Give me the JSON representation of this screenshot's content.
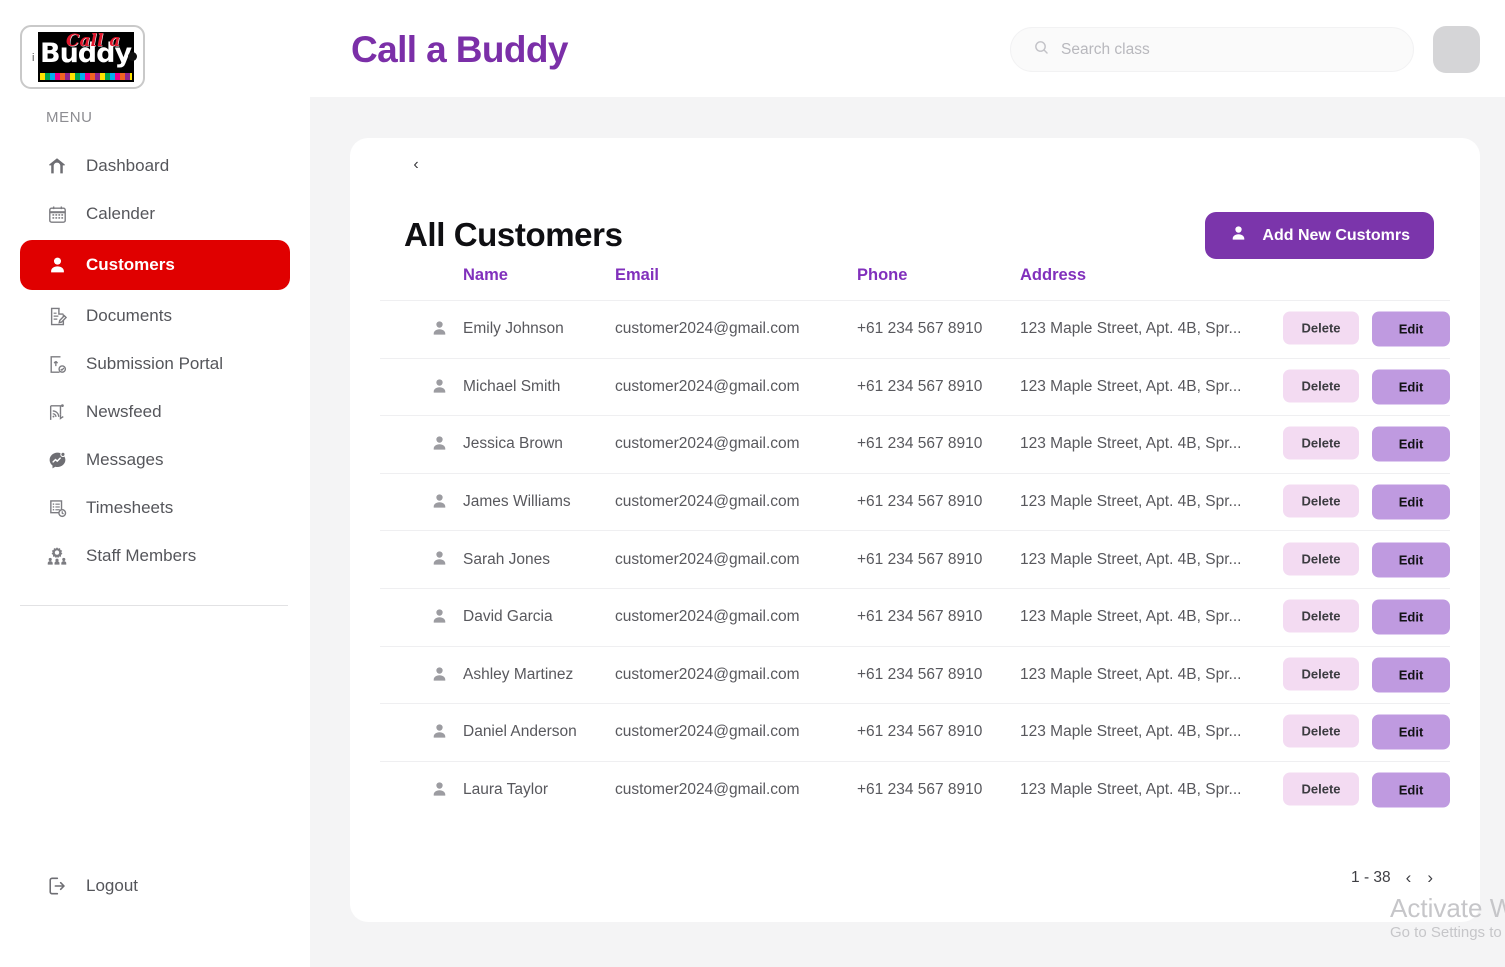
{
  "brand": {
    "logo_main": "Buddy",
    "logo_script": "Call a",
    "logo_left_letter": "i",
    "app_title": "Call a Buddy",
    "accent_purple": "#7b2fa8",
    "accent_red": "#e00000"
  },
  "sidebar": {
    "menu_label": "MENU",
    "items": [
      {
        "label": "Dashboard",
        "icon": "home-icon",
        "active": false
      },
      {
        "label": "Calender",
        "icon": "calendar-icon",
        "active": false
      },
      {
        "label": "Customers",
        "icon": "user-icon",
        "active": true
      },
      {
        "label": "Documents",
        "icon": "document-edit-icon",
        "active": false
      },
      {
        "label": "Submission Portal",
        "icon": "upload-check-icon",
        "active": false
      },
      {
        "label": "Newsfeed",
        "icon": "rss-icon",
        "active": false
      },
      {
        "label": "Messages",
        "icon": "message-chart-icon",
        "active": false
      },
      {
        "label": "Timesheets",
        "icon": "timesheet-clock-icon",
        "active": false
      },
      {
        "label": "Staff Members",
        "icon": "staff-group-icon",
        "active": false
      }
    ],
    "logout_label": "Logout"
  },
  "search": {
    "placeholder": "Search class",
    "value": ""
  },
  "main": {
    "back_label": "‹",
    "page_title": "All Customers",
    "add_button_label": "Add New Customrs",
    "columns": [
      "Name",
      "Email",
      "Phone",
      "Address"
    ],
    "rows": [
      {
        "name": "Emily Johnson",
        "email": "customer2024@gmail.com",
        "phone": "+61 234 567 8910",
        "address": "123 Maple Street, Apt. 4B, Spr..."
      },
      {
        "name": "Michael Smith",
        "email": "customer2024@gmail.com",
        "phone": "+61 234 567 8910",
        "address": "123 Maple Street, Apt. 4B, Spr..."
      },
      {
        "name": "Jessica Brown",
        "email": "customer2024@gmail.com",
        "phone": "+61 234 567 8910",
        "address": "123 Maple Street, Apt. 4B, Spr..."
      },
      {
        "name": "James Williams",
        "email": "customer2024@gmail.com",
        "phone": "+61 234 567 8910",
        "address": "123 Maple Street, Apt. 4B, Spr..."
      },
      {
        "name": "Sarah Jones",
        "email": "customer2024@gmail.com",
        "phone": "+61 234 567 8910",
        "address": "123 Maple Street, Apt. 4B, Spr..."
      },
      {
        "name": "David Garcia",
        "email": "customer2024@gmail.com",
        "phone": "+61 234 567 8910",
        "address": "123 Maple Street, Apt. 4B, Spr..."
      },
      {
        "name": "Ashley Martinez",
        "email": "customer2024@gmail.com",
        "phone": "+61 234 567 8910",
        "address": "123 Maple Street, Apt. 4B, Spr..."
      },
      {
        "name": "Daniel Anderson",
        "email": "customer2024@gmail.com",
        "phone": "+61 234 567 8910",
        "address": "123 Maple Street, Apt. 4B, Spr..."
      },
      {
        "name": "Laura Taylor",
        "email": "customer2024@gmail.com",
        "phone": "+61 234 567 8910",
        "address": "123 Maple Street, Apt. 4B, Spr..."
      }
    ],
    "delete_label": "Delete",
    "edit_label": "Edit",
    "pagination": {
      "range": "1 - 38",
      "prev": "‹",
      "next": "›"
    }
  },
  "watermark": {
    "line1": "Activate Win",
    "line2": "Go to Settings to"
  }
}
